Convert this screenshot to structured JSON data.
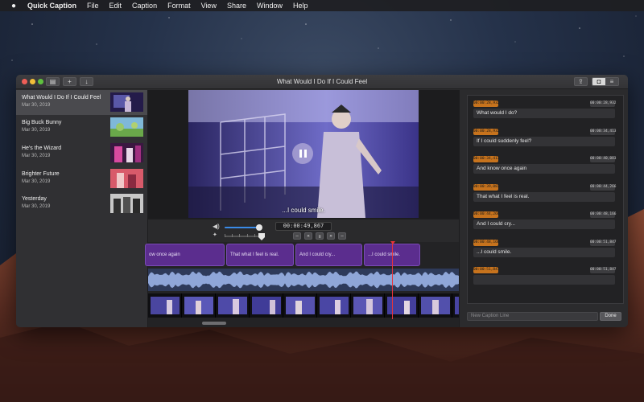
{
  "menubar": {
    "app_name": "Quick Caption",
    "items": [
      "File",
      "Edit",
      "Caption",
      "Format",
      "View",
      "Share",
      "Window",
      "Help"
    ]
  },
  "window": {
    "title": "What Would I Do If I Could Feel",
    "toolbar": {
      "sidebar_icon": "sidebar-icon",
      "add_icon": "plus-icon",
      "download_icon": "download-icon",
      "share_icon": "share-icon"
    }
  },
  "sidebar": {
    "items": [
      {
        "title": "What Would I Do If I Could Feel",
        "date": "Mar 30, 2019",
        "selected": true
      },
      {
        "title": "Big Buck Bunny",
        "date": "Mar 30, 2019",
        "selected": false
      },
      {
        "title": "He's the Wizard",
        "date": "Mar 30, 2019",
        "selected": false
      },
      {
        "title": "Brighter Future",
        "date": "Mar 30, 2019",
        "selected": false
      },
      {
        "title": "Yesterday",
        "date": "Mar 30, 2019",
        "selected": false
      }
    ]
  },
  "player": {
    "subtitle": "...I could smile.",
    "timecode": "00:00:49,867",
    "volume": 0.92,
    "speed": 1.0
  },
  "timeline": {
    "caption_blocks": [
      {
        "text": "ow once again"
      },
      {
        "text": "That what I feel is real."
      },
      {
        "text": "And I could cry..."
      },
      {
        "text": "...I could smile."
      }
    ]
  },
  "captions": [
    {
      "start": "00:00:28,932",
      "end": "00:00:28,932",
      "text": "What would I do?"
    },
    {
      "start": "00:00:28,932",
      "end": "00:00:34,413",
      "text": "If I could suddenly feel?"
    },
    {
      "start": "00:00:34,413",
      "end": "00:00:40,083",
      "text": "And know once again"
    },
    {
      "start": "00:00:39,083",
      "end": "00:00:44,266",
      "text": "That what I feel is real."
    },
    {
      "start": "00:00:44,266",
      "end": "00:00:48,166",
      "text": "And I could cry..."
    },
    {
      "start": "00:00:48,166",
      "end": "00:00:51,847",
      "text": "...I could smile."
    },
    {
      "start": "00:00:51,847",
      "end": "00:00:51,847",
      "text": ""
    }
  ],
  "panel": {
    "new_caption_placeholder": "New Caption Line",
    "done_label": "Done"
  },
  "colors": {
    "accent": "#3a8be8",
    "caption_block": "#5b2d8e",
    "start_badge": "#c7731d",
    "playhead": "#e8343a"
  }
}
